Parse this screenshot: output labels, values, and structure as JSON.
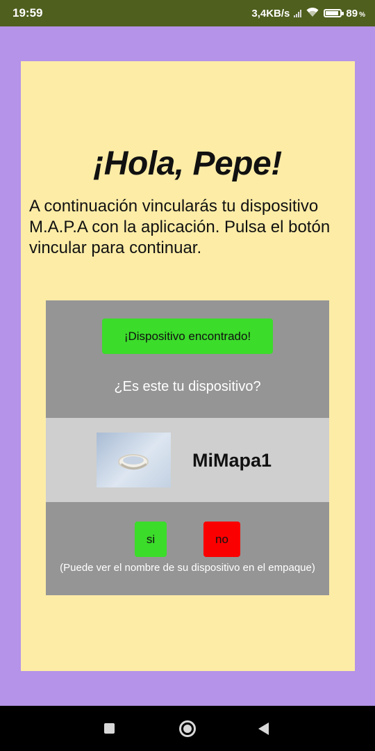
{
  "status_bar": {
    "time": "19:59",
    "network_speed": "3,4KB/s",
    "battery_level": "89",
    "battery_unit": "%",
    "battery_fraction": 0.89,
    "signal_icon": "signal-icon",
    "wifi_icon": "wifi-icon",
    "battery_icon": "battery-icon"
  },
  "main": {
    "greeting": "¡Hola, Pepe!",
    "intro": "A continuación vincularás tu dispositivo M.A.P.A con la aplicación. Pulsa el botón vincular para continuar."
  },
  "device_panel": {
    "found_label": "¡Dispositivo encontrado!",
    "question": "¿Es este tu dispositivo?",
    "device_name": "MiMapa1",
    "device_image_icon": "bracelet-image",
    "yes_label": "si",
    "no_label": "no",
    "hint": "(Puede ver el nombre de su dispositivo en el empaque)"
  },
  "nav_bar": {
    "recent_icon": "square-icon",
    "home_icon": "home-circle-icon",
    "back_icon": "back-triangle-icon"
  },
  "colors": {
    "status_bar": "#4f5f1e",
    "background": "#b593e8",
    "card": "#fdeca6",
    "panel_dark": "#959595",
    "panel_light": "#cfcfcf",
    "accent_green": "#3bdc2a",
    "accent_red": "#fb0000"
  }
}
